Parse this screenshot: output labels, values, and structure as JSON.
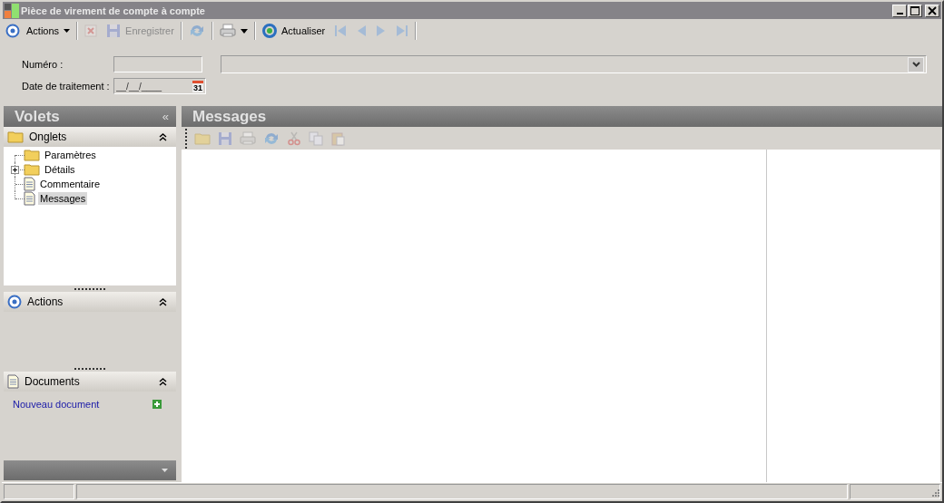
{
  "window": {
    "title": "Pièce de virement de compte à compte"
  },
  "toolbar": [
    {
      "kind": "target",
      "label": "Actions",
      "disabled": false
    },
    {
      "kind": "separator"
    },
    {
      "kind": "delete",
      "disabled": true
    },
    {
      "kind": "save",
      "label": "Enregistrer",
      "disabled": true
    },
    {
      "kind": "separator"
    },
    {
      "kind": "refresh",
      "disabled": true
    },
    {
      "kind": "separator"
    },
    {
      "kind": "print",
      "disabled": false
    },
    {
      "kind": "separator"
    },
    {
      "kind": "reload",
      "label": "Actualiser",
      "disabled": false
    },
    {
      "kind": "first",
      "disabled": true
    },
    {
      "kind": "prev",
      "disabled": true
    },
    {
      "kind": "next",
      "disabled": true
    },
    {
      "kind": "last",
      "disabled": true
    },
    {
      "kind": "separator"
    }
  ],
  "form": {
    "numero": {
      "label": "Numéro :"
    },
    "date": {
      "label": "Date de traitement :",
      "placeholder": "__/__/____",
      "calendar_day": "31"
    }
  },
  "sidebar": {
    "title": "Volets",
    "collapse_glyph": "«",
    "sections": [
      {
        "kind": "tabs",
        "title": "Onglets",
        "expanded": true,
        "items": [
          {
            "kind": "folder",
            "label": "Paramètres",
            "selected": false,
            "expandable": false
          },
          {
            "kind": "folder",
            "label": "Détails",
            "selected": false,
            "expandable": true
          },
          {
            "kind": "document",
            "label": "Commentaire",
            "selected": false,
            "expandable": false
          },
          {
            "kind": "document",
            "label": "Messages",
            "selected": true,
            "expandable": false
          }
        ]
      },
      {
        "kind": "actions",
        "title": "Actions",
        "expanded": true
      },
      {
        "kind": "documents",
        "title": "Documents",
        "expanded": true,
        "link": "Nouveau document"
      }
    ]
  },
  "main": {
    "title": "Messages",
    "toolbar": [
      {
        "kind": "open",
        "disabled": true
      },
      {
        "kind": "save",
        "disabled": true
      },
      {
        "kind": "print",
        "disabled": true
      },
      {
        "kind": "refresh",
        "disabled": true
      },
      {
        "kind": "cut",
        "disabled": true
      },
      {
        "kind": "copy",
        "disabled": true
      },
      {
        "kind": "paste",
        "disabled": true
      }
    ]
  }
}
